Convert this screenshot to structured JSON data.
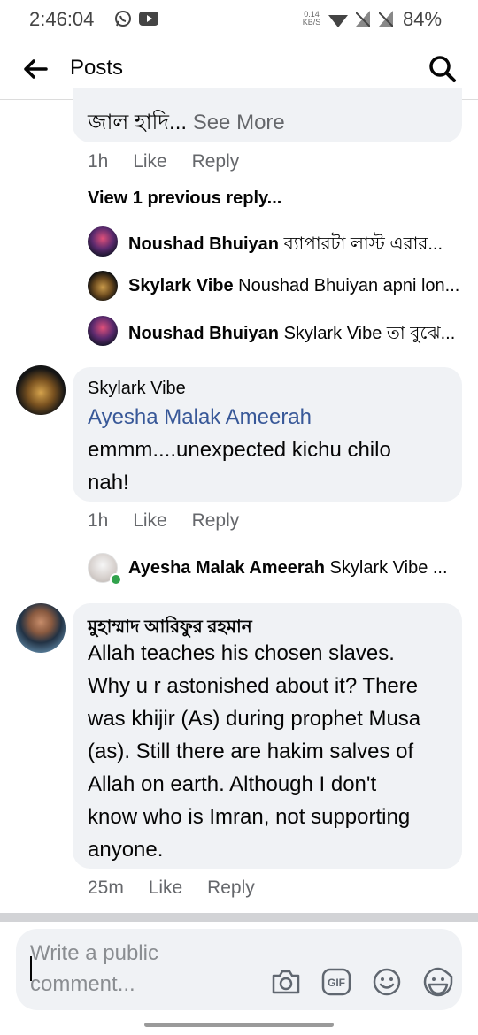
{
  "status": {
    "time": "2:46:04",
    "speed_value": "0.14",
    "speed_unit": "KB/S",
    "battery": "84%"
  },
  "header": {
    "title": "Posts"
  },
  "comment1": {
    "text_tail": "জাল হাদি...",
    "see_more": "See More",
    "time": "1h",
    "like": "Like",
    "reply": "Reply"
  },
  "view_previous": "View 1 previous reply...",
  "replies": [
    {
      "author": "Noushad Bhuiyan",
      "text": "ব্যাপারটা লাস্ট এরার..."
    },
    {
      "author": "Skylark Vibe",
      "text": "Noushad Bhuiyan apni lon..."
    },
    {
      "author": "Noushad Bhuiyan",
      "text": "Skylark Vibe তা বুঝে..."
    }
  ],
  "comment2": {
    "author": "Skylark Vibe",
    "mention": "Ayesha Malak Ameerah",
    "line1": "emmm....unexpected kichu chilo",
    "line2": "nah!",
    "time": "1h",
    "like": "Like",
    "reply": "Reply"
  },
  "reply4": {
    "author": "Ayesha Malak Ameerah",
    "text": "Skylark Vibe  ..."
  },
  "comment3": {
    "author": "মুহাম্মাদ আরিফুর রহমান",
    "lines": [
      "Allah teaches his chosen slaves.",
      "Why u r astonished about it? There",
      "was khijir (As) during prophet Musa",
      "(as). Still there are hakim salves of",
      "Allah on earth. Although I don't",
      "know who is Imran, not supporting",
      "anyone."
    ],
    "time": "25m",
    "like": "Like",
    "reply": "Reply"
  },
  "composer": {
    "placeholder_line1": "Write a public",
    "placeholder_line2": "comment..."
  },
  "icons": [
    "whatsapp-icon",
    "youtube-icon",
    "wifi-icon",
    "sim-icon",
    "back-arrow-icon",
    "search-icon",
    "camera-icon",
    "gif-icon",
    "emoji-icon",
    "sticker-icon"
  ]
}
